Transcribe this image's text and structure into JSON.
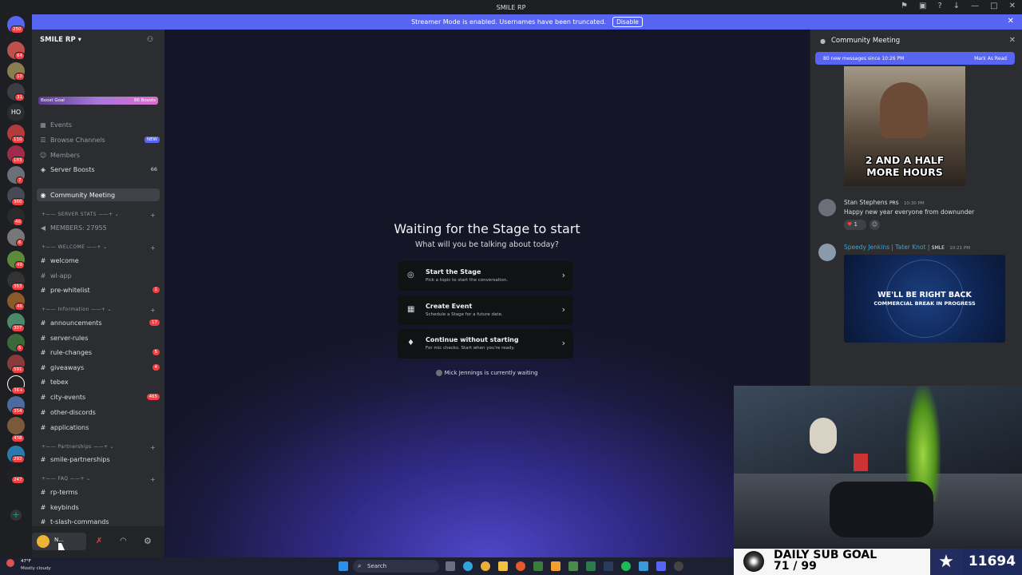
{
  "window": {
    "title": "SMILE RP"
  },
  "banner": {
    "text": "Streamer Mode is enabled. Usernames have been truncated.",
    "button": "Disable"
  },
  "guild_badges": [
    "250",
    "64",
    "10",
    "31",
    "HO",
    "110",
    "183",
    "7",
    "360",
    "46",
    "6",
    "49",
    "353",
    "46",
    "307",
    "5",
    "591",
    "3K+",
    "354",
    "438",
    "292",
    "247"
  ],
  "sidebar": {
    "server_name": "SMILE RP",
    "boost_goal_label": "Boost Goal",
    "boost_count": "86 Boosts",
    "events": "Events",
    "browse_channels": "Browse Channels",
    "browse_badge": "NEW",
    "members": "Members",
    "server_boosts": "Server Boosts",
    "server_boosts_count": "66",
    "community_meeting": "Community Meeting",
    "cat_server_stats": "SERVER STATS",
    "members_count": "MEMBERS: 27955",
    "cat_welcome": "WELCOME",
    "welcome": "welcome",
    "wl_app": "wl-app",
    "pre_whitelist": "pre-whitelist",
    "pre_whitelist_count": "1",
    "cat_information": "Information",
    "announcements": "announcements",
    "announcements_count": "17",
    "server_rules": "server-rules",
    "rule_changes": "rule-changes",
    "rule_changes_count": "5",
    "giveaways": "giveaways",
    "giveaways_count": "4",
    "tebex": "tebex",
    "city_events": "city-events",
    "city_events_count": "465",
    "other_discords": "other-discords",
    "applications": "applications",
    "cat_partnerships": "Partnerships",
    "smile_partnerships": "smile-partnerships",
    "cat_faq": "FAQ",
    "rp_terms": "rp-terms",
    "keybinds": "keybinds",
    "slash_commands": "t-slash-commands",
    "user_name": "N..."
  },
  "weather": {
    "temp": "47°F",
    "desc": "Mostly cloudy"
  },
  "stage": {
    "title": "Waiting for the Stage to start",
    "subtitle": "What will you be talking about today?",
    "options": [
      {
        "title": "Start the Stage",
        "desc": "Pick a topic to start the conversation."
      },
      {
        "title": "Create Event",
        "desc": "Schedule a Stage for a future date."
      },
      {
        "title": "Continue without starting",
        "desc": "For mic checks. Start when you're ready."
      }
    ],
    "waiting": "Mick Jennings is currently waiting"
  },
  "chat": {
    "title": "Community Meeting",
    "new_messages": "80 new messages since 10:26 PM",
    "mark_as_read": "Mark As Read",
    "gif_caption_1": "2 AND A HALF",
    "gif_caption_2": "MORE HOURS",
    "msg1": {
      "name": "Stan Stephens",
      "tag": "PRS",
      "time": "10:30 PM",
      "text": "Happy new year everyone from downunder",
      "reaction": "1"
    },
    "msg2": {
      "name": "Speedy Jenkins | Tater Knot |",
      "tag": "SMLE",
      "time": "10:21 PM"
    },
    "brb_1": "WE'LL BE RIGHT BACK",
    "brb_2": "COMMERCIAL BREAK IN PROGRESS"
  },
  "overlay": {
    "goal_label": "DAILY SUB GOAL",
    "goal_progress": "71 / 99",
    "count": "11694"
  },
  "taskbar": {
    "search": "Search"
  },
  "colors": {
    "blurple": "#5865f2",
    "sidebar": "#2b2d31",
    "red": "#f23f43"
  }
}
